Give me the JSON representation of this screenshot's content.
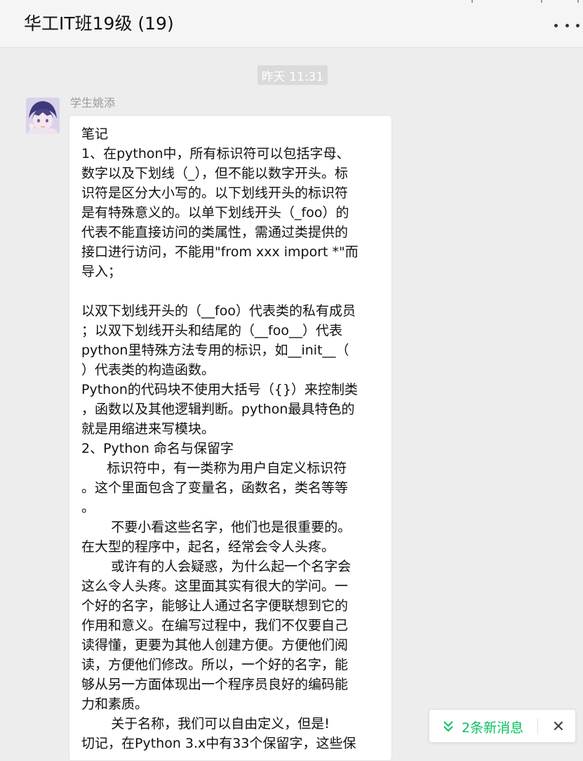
{
  "header": {
    "title": "华工IT班19级 (19)",
    "more_icon": "more-horizontal-icon"
  },
  "chat": {
    "timestamp": "昨天 11:31",
    "message": {
      "sender": "学生姚添",
      "lines": [
        "笔记",
        "1、在python中，所有标识符可以包括字母、",
        "数字以及下划线（_），但不能以数字开头。标",
        "识符是区分大小写的。以下划线开头的标识符",
        "是有特殊意义的。以单下划线开头（_foo）的",
        "代表不能直接访问的类属性，需通过类提供的",
        "接口进行访问，不能用\"from xxx import *\"而",
        "导入；",
        "",
        "以双下划线开头的（__foo）代表类的私有成员",
        "；以双下划线开头和结尾的（__foo__）代表",
        "python里特殊方法专用的标识，如__init__（",
        "）代表类的构造函数。",
        "Python的代码块不使用大括号（{}）来控制类",
        "，函数以及其他逻辑判断。python最具特色的",
        "就是用缩进来写模块。",
        "2、Python 命名与保留字",
        "      标识符中，有一类称为用户自定义标识符",
        "。这个里面包含了变量名，函数名，类名等等",
        "。",
        "       不要小看这些名字，他们也是很重要的。",
        "在大型的程序中，起名，经常会令人头疼。",
        "       或许有的人会疑惑，为什么起一个名字会",
        "这么令人头疼。这里面其实有很大的学问。一",
        "个好的名字，能够让人通过名字便联想到它的",
        "作用和意义。在编写过程中，我们不仅要自己",
        "读得懂，更要为其他人创建方便。方便他们阅",
        "读，方便他们修改。所以，一个好的名字，能",
        "够从另一方面体现出一个程序员良好的编码能",
        "力和素质。",
        "       关于名称，我们可以自由定义，但是!",
        "切记，在Python 3.x中有33个保留字，这些保"
      ]
    }
  },
  "toast": {
    "text": "2条新消息",
    "icon": "double-chevron-down-icon",
    "close_icon": "close-icon",
    "accent": "#07c160"
  }
}
